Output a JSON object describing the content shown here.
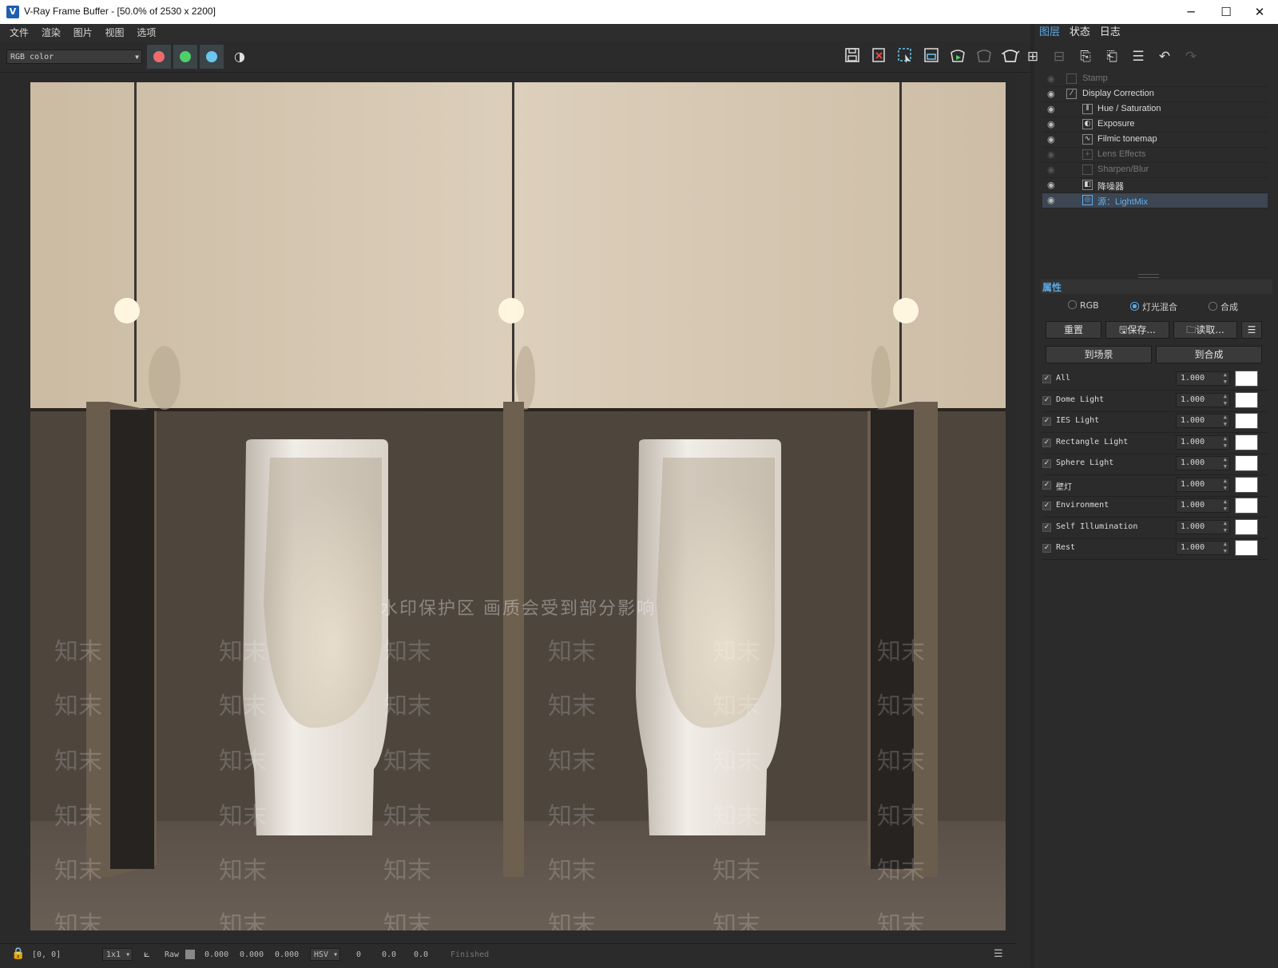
{
  "window": {
    "title": "V-Ray Frame Buffer - [50.0% of 2530 x 2200]",
    "app_icon": "V",
    "minimize": "─",
    "maximize": "☐",
    "close": "✕"
  },
  "menu": [
    "文件",
    "渲染",
    "图片",
    "视图",
    "选项"
  ],
  "toolbar": {
    "channel": "RGB color",
    "channel_buttons": [
      {
        "name": "red-channel",
        "color": "#ee6b6e"
      },
      {
        "name": "green-channel",
        "color": "#4fcf6a"
      },
      {
        "name": "blue-channel",
        "color": "#6cc6ef"
      }
    ]
  },
  "watermark": {
    "banner": "水印保护区 画质会受到部分影响",
    "tile": "知末"
  },
  "status": {
    "coords": "[0, 0]",
    "zoom": "1x1",
    "mode": "Raw",
    "r": "0.000",
    "g": "0.000",
    "b": "0.000",
    "colorspace": "HSV",
    "h": "0",
    "s": "0.0",
    "v": "0.0",
    "state": "Finished"
  },
  "panel": {
    "tabs": [
      "图层",
      "状态",
      "日志"
    ],
    "layers": [
      {
        "name": "Stamp",
        "visible": false,
        "indent": 1
      },
      {
        "name": "Display Correction",
        "visible": true,
        "indent": 1
      },
      {
        "name": "Hue / Saturation",
        "visible": true,
        "indent": 2
      },
      {
        "name": "Exposure",
        "visible": true,
        "indent": 2
      },
      {
        "name": "Filmic tonemap",
        "visible": true,
        "indent": 2
      },
      {
        "name": "Lens Effects",
        "visible": false,
        "indent": 2
      },
      {
        "name": "Sharpen/Blur",
        "visible": false,
        "indent": 2
      },
      {
        "name": "降噪器",
        "visible": true,
        "indent": 2
      },
      {
        "name": "源：LightMix",
        "visible": true,
        "indent": 2,
        "selected": true
      }
    ],
    "properties_label": "属性",
    "radios": [
      {
        "label": "RGB",
        "selected": false
      },
      {
        "label": "灯光混合",
        "selected": true
      },
      {
        "label": "合成",
        "selected": false
      }
    ],
    "reset": "重置",
    "save": "保存...",
    "load": "读取...",
    "to_scene": "到场景",
    "to_composite": "到合成",
    "lights": [
      {
        "name": "All",
        "value": "1.000"
      },
      {
        "name": "Dome Light",
        "value": "1.000"
      },
      {
        "name": "IES Light",
        "value": "1.000"
      },
      {
        "name": "Rectangle Light",
        "value": "1.000"
      },
      {
        "name": "Sphere Light",
        "value": "1.000"
      },
      {
        "name": "壁灯",
        "value": "1.000"
      },
      {
        "name": "Environment",
        "value": "1.000"
      },
      {
        "name": "Self Illumination",
        "value": "1.000"
      },
      {
        "name": "Rest",
        "value": "1.000"
      }
    ]
  }
}
